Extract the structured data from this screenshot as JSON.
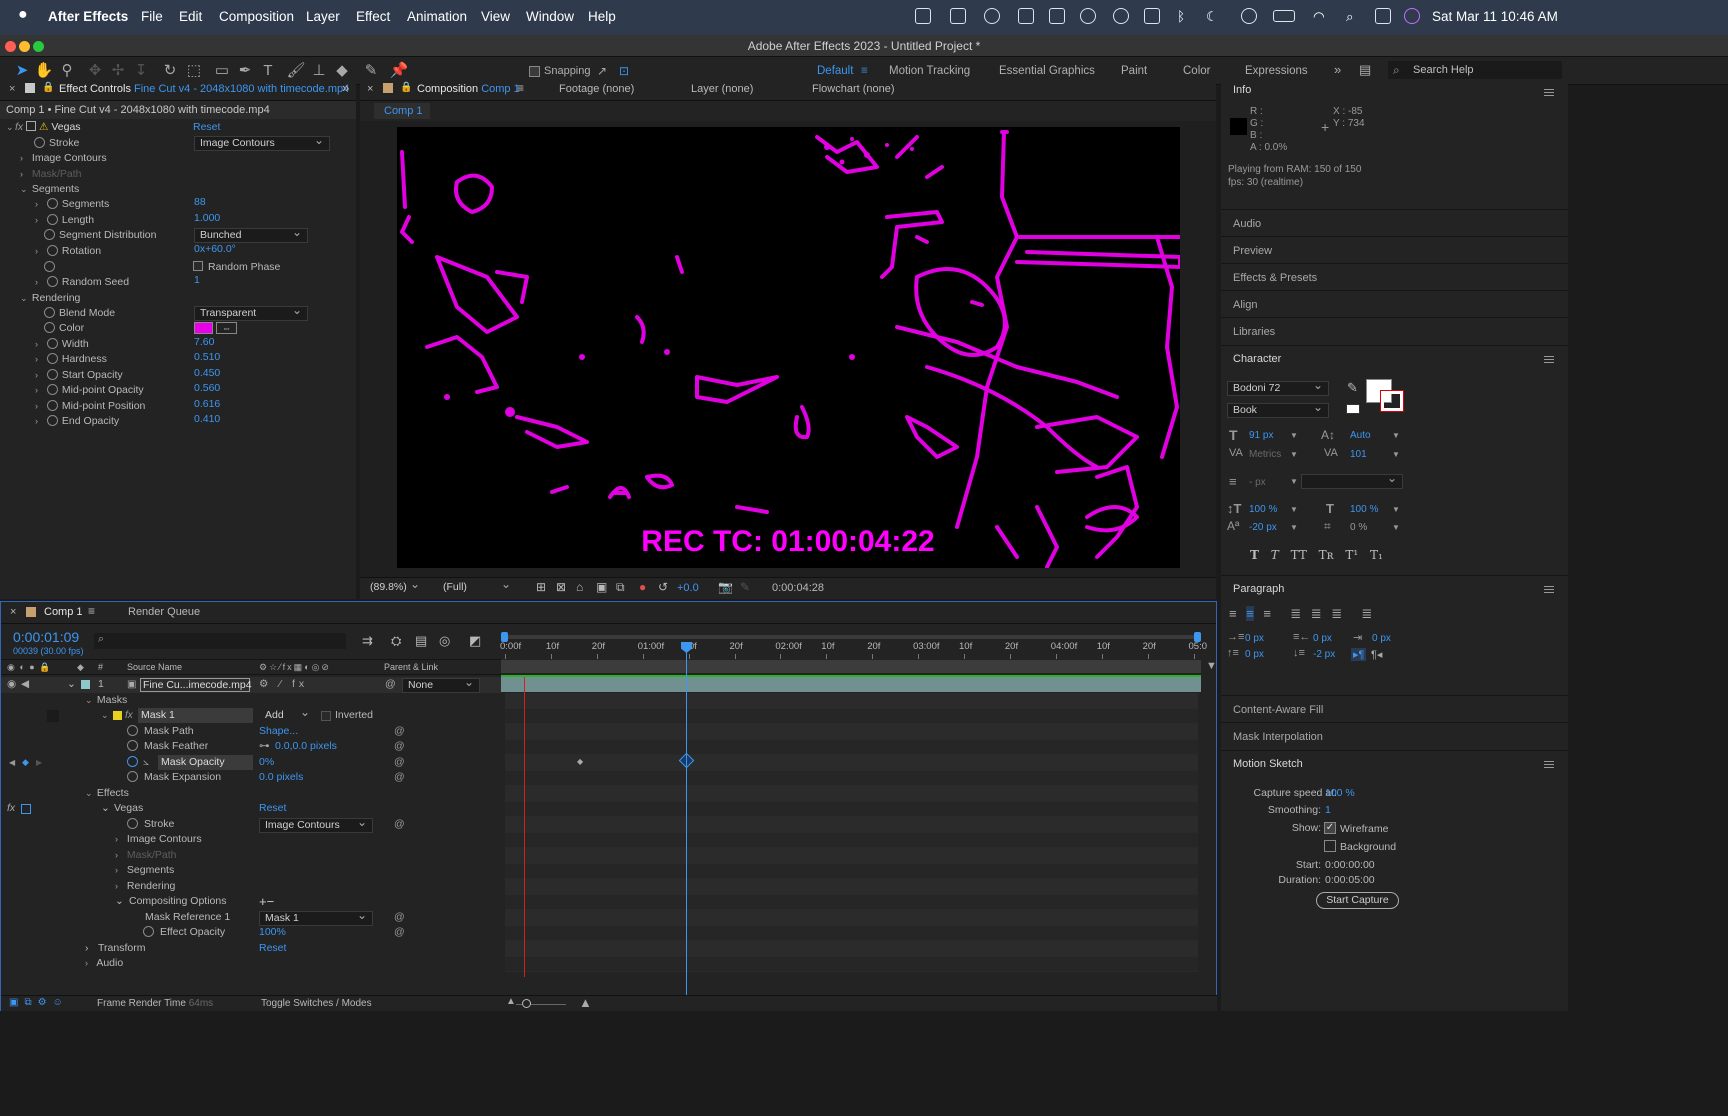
{
  "menubar": {
    "apple": "",
    "app": "After Effects",
    "items": [
      "File",
      "Edit",
      "Composition",
      "Layer",
      "Effect",
      "Animation",
      "View",
      "Window",
      "Help"
    ],
    "datetime": "Sat Mar 11  10:46 AM"
  },
  "window": {
    "title": "Adobe After Effects 2023 - Untitled Project *"
  },
  "toolbar": {
    "snapping": "Snapping",
    "workspaces": [
      "Default",
      "Motion Tracking",
      "Essential Graphics",
      "Paint",
      "Color",
      "Expressions"
    ],
    "search_placeholder": "Search Help"
  },
  "effect_controls": {
    "tab_label": "Effect Controls",
    "tab_file": "Fine Cut v4 - 2048x1080 with timecode.mp4",
    "subheader": "Comp 1 • Fine Cut v4 - 2048x1080 with timecode.mp4",
    "effect_name": "Vegas",
    "reset": "Reset",
    "stroke_label": "Stroke",
    "stroke_value": "Image Contours",
    "image_contours": "Image Contours",
    "mask_path": "Mask/Path",
    "segments_group": "Segments",
    "segments_label": "Segments",
    "segments_value": "88",
    "length_label": "Length",
    "length_value": "1.000",
    "distribution_label": "Segment Distribution",
    "distribution_value": "Bunched",
    "rotation_label": "Rotation",
    "rotation_value": "0x+60.0°",
    "random_phase": "Random Phase",
    "seed_label": "Random Seed",
    "seed_value": "1",
    "rendering_group": "Rendering",
    "blend_label": "Blend Mode",
    "blend_value": "Transparent",
    "color_label": "Color",
    "color_hex": "#e800e8",
    "width_label": "Width",
    "width_value": "7.60",
    "hardness_label": "Hardness",
    "hardness_value": "0.510",
    "start_opacity_label": "Start Opacity",
    "start_opacity_value": "0.450",
    "mid_opacity_label": "Mid-point Opacity",
    "mid_opacity_value": "0.560",
    "mid_position_label": "Mid-point Position",
    "mid_position_value": "0.616",
    "end_opacity_label": "End Opacity",
    "end_opacity_value": "0.410"
  },
  "comp_panel": {
    "tab_label": "Composition",
    "tab_comp": "Comp 1",
    "footage": "Footage",
    "footage_val": "(none)",
    "layer": "Layer",
    "layer_val": "(none)",
    "flowchart": "Flowchart",
    "flowchart_val": "(none)",
    "subtab": "Comp 1",
    "overlay_text": "REC TC: 01:00:04:22",
    "zoom": "(89.8%)",
    "resolution": "(Full)",
    "exposure": "+0.0",
    "timecode": "0:00:04:28"
  },
  "info": {
    "title": "Info",
    "r": "R :",
    "g": "G :",
    "b": "B :",
    "a": "A :  0.0%",
    "x": "X : -85",
    "y": "Y : 734",
    "playing": "Playing from RAM: 150 of 150",
    "fps": "fps: 30 (realtime)"
  },
  "right_sections": [
    "Audio",
    "Preview",
    "Effects & Presets",
    "Align",
    "Libraries"
  ],
  "character": {
    "title": "Character",
    "font": "Bodoni 72",
    "style": "Book",
    "size": "91 px",
    "leading": "Auto",
    "kerning": "Metrics",
    "tracking": "101",
    "stroke_w": "- px",
    "vscale": "100 %",
    "hscale": "100 %",
    "baseline": "-20 px",
    "tsume": "0 %"
  },
  "paragraph": {
    "title": "Paragraph",
    "indent_l": "0 px",
    "indent_r": "0 px",
    "indent_f": "0 px",
    "space_b": "0 px",
    "space_a": "-2 px"
  },
  "more_sections": [
    "Content-Aware Fill",
    "Mask Interpolation"
  ],
  "motion_sketch": {
    "title": "Motion Sketch",
    "capture_label": "Capture speed at:",
    "capture_value": "100 %",
    "smoothing_label": "Smoothing:",
    "smoothing_value": "1",
    "show_label": "Show:",
    "wireframe": "Wireframe",
    "background": "Background",
    "start_label": "Start:",
    "start_value": "0:00:00:00",
    "duration_label": "Duration:",
    "duration_value": "0:00:05:00",
    "button": "Start Capture"
  },
  "timeline": {
    "tab": "Comp 1",
    "render_queue": "Render Queue",
    "timecode": "0:00:01:09",
    "frames": "00039 (30.00 fps)",
    "col_source": "Source Name",
    "col_parent": "Parent & Link",
    "col_num": "#",
    "ruler": [
      "0:00f",
      "10f",
      "20f",
      "01:00f",
      "10f",
      "20f",
      "02:00f",
      "10f",
      "20f",
      "03:00f",
      "10f",
      "20f",
      "04:00f",
      "10f",
      "20f",
      "05:0"
    ],
    "layer_num": "1",
    "layer_name": "Fine Cu...imecode.mp4",
    "parent": "None",
    "masks": "Masks",
    "mask1": "Mask 1",
    "mask_mode": "Add",
    "inverted": "Inverted",
    "mask_path": "Mask Path",
    "mask_path_val": "Shape...",
    "mask_feather": "Mask Feather",
    "mask_feather_val": "0.0,0.0 pixels",
    "mask_opacity": "Mask Opacity",
    "mask_opacity_val": "0%",
    "mask_expansion": "Mask Expansion",
    "mask_expansion_val": "0.0 pixels",
    "effects": "Effects",
    "vegas": "Vegas",
    "reset": "Reset",
    "stroke": "Stroke",
    "stroke_val": "Image Contours",
    "image_contours": "Image Contours",
    "mask_path2": "Mask/Path",
    "segments": "Segments",
    "rendering": "Rendering",
    "compositing": "Compositing Options",
    "mask_ref": "Mask Reference 1",
    "mask_ref_val": "Mask 1",
    "effect_opacity": "Effect Opacity",
    "effect_opacity_val": "100%",
    "transform": "Transform",
    "transform_reset": "Reset",
    "audio": "Audio",
    "footer_label": "Frame Render Time",
    "footer_val": "64ms",
    "toggle": "Toggle Switches / Modes"
  }
}
